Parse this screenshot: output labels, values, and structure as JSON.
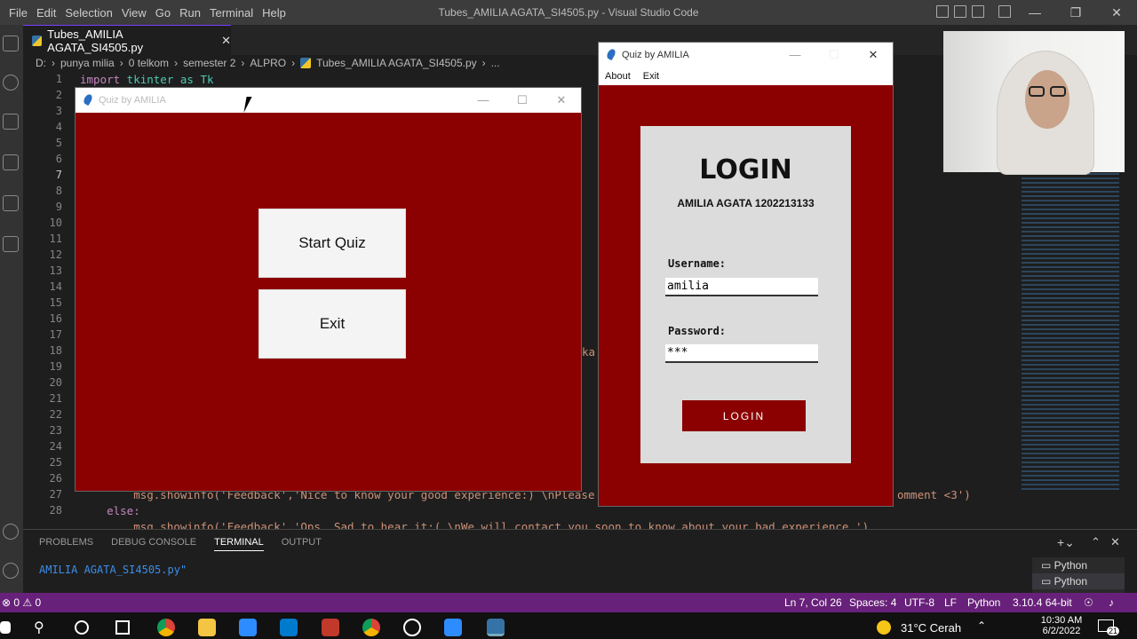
{
  "vscode": {
    "menu": [
      "File",
      "Edit",
      "Selection",
      "View",
      "Go",
      "Run",
      "Terminal",
      "Help"
    ],
    "title": "Tubes_AMILIA AGATA_SI4505.py - Visual Studio Code",
    "tab_label": "Tubes_AMILIA AGATA_SI4505.py",
    "breadcrumb": [
      "D:",
      "punya milia",
      "0 telkom",
      "semester 2",
      "ALPRO",
      "Tubes_AMILIA AGATA_SI4505.py",
      "..."
    ],
    "line_numbers": [
      "1",
      "2",
      "3",
      "4",
      "5",
      "6",
      "7",
      "8",
      "9",
      "10",
      "11",
      "12",
      "13",
      "14",
      "15",
      "16",
      "17",
      "18",
      "19",
      "20",
      "21",
      "22",
      "23",
      "24",
      "25",
      "26",
      "27",
      "28"
    ],
    "code": {
      "line1_kw": "import",
      "line1_rest": " tkinter as Tk",
      "line27": "        msg.showinfo('Feedback','Nice to know your good experience:) \\nPlease Li",
      "line27_tail": "omment <3')",
      "line28": "    else:",
      "line29": "        msg.showinfo('Feedback','Ops. Sad to hear it:( \\nWe will contact you soon to know about your bad experience.')",
      "line18_fragment": "ka"
    },
    "panel_tabs": [
      "PROBLEMS",
      "DEBUG CONSOLE",
      "TERMINAL",
      "OUTPUT"
    ],
    "terminal_text": "AMILIA AGATA_SI4505.py\"",
    "terminal_list": [
      "Python",
      "Python"
    ],
    "status": {
      "left": "⊗ 0 ⚠ 0",
      "position": "Ln 7, Col 26",
      "spaces": "Spaces: 4",
      "encoding": "UTF-8",
      "eol": "LF",
      "language": "Python",
      "interpreter": "3.10.4 64-bit"
    }
  },
  "quiz_main": {
    "title": "Quiz by AMILIA",
    "start_label": "Start Quiz",
    "exit_label": "Exit"
  },
  "login_window": {
    "title": "Quiz by AMILIA",
    "menu": [
      "About",
      "Exit"
    ],
    "heading": "LOGIN",
    "subtitle": "AMILIA AGATA 1202213133",
    "username_label": "Username:",
    "username_value": "amilia",
    "password_label": "Password:",
    "password_value": "***",
    "login_button": "LOGIN"
  },
  "taskbar": {
    "weather": "31°C  Cerah",
    "time": "10:30 AM",
    "date": "6/2/2022",
    "notif_count": "21"
  },
  "colors": {
    "tk_bg": "#8b0000",
    "statusbar": "#68217a",
    "login_panel": "#dcdcdc"
  }
}
